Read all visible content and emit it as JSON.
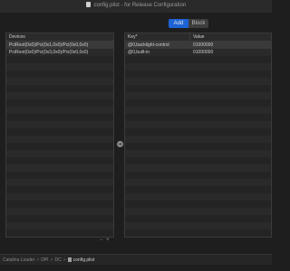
{
  "window": {
    "title": "config.plist - for Release Configuration"
  },
  "segmented": {
    "add": "Add",
    "block": "Block"
  },
  "left_panel": {
    "header": "Devices",
    "rows": [
      "PciRoot(0x0)/Pci(0x1,0x0)/Pci(0x0,0x0)",
      "PciRoot(0x0)/Pci(0x3,0x0)/Pci(0x0,0x0)"
    ],
    "footer": "− +"
  },
  "right_panel": {
    "header_key": "Key*",
    "header_value": "Value",
    "rows": [
      {
        "key": "@0,backlight-control",
        "value": "01000000"
      },
      {
        "key": "@0,built-in",
        "value": "01000000"
      }
    ]
  },
  "arrow_glyph": "➔",
  "statusbar": {
    "items": [
      "Catalina Loader",
      "DPI",
      "DC",
      "config.plist"
    ],
    "separator": ">"
  },
  "colors": {
    "accent": "#1d63d6",
    "background": "#1e1e1e",
    "panel": "#242424"
  }
}
